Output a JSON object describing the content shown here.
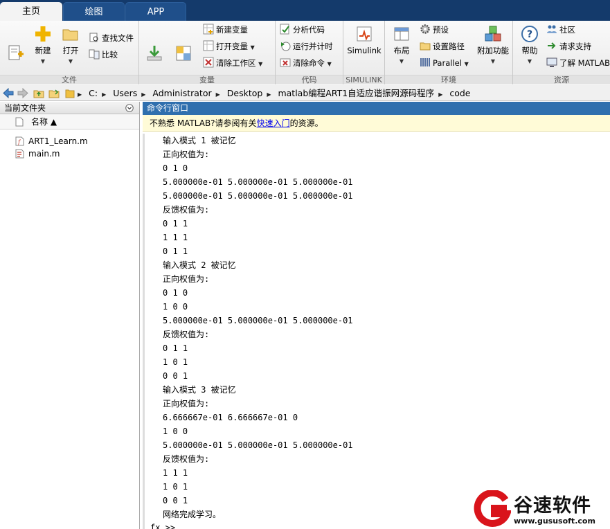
{
  "tabs": [
    "主页",
    "绘图",
    "APP"
  ],
  "ribbon": {
    "file_group": {
      "label": "文件",
      "new_script": "新建\n脚本",
      "new": "新建",
      "open": "打开",
      "find_files": "查找文件",
      "compare": "比较"
    },
    "variable_group": {
      "label": "变量",
      "import_data": "导入\n数据",
      "save_workspace": "保存\n工作区",
      "new_variable": "新建变量",
      "open_variable": "打开变量",
      "clear_workspace": "清除工作区"
    },
    "code_group": {
      "label": "代码",
      "analyze_code": "分析代码",
      "run_and_time": "运行并计时",
      "clear_commands": "清除命令"
    },
    "simulink_group": {
      "label": "SIMULINK",
      "simulink": "Simulink"
    },
    "env_group": {
      "label": "环境",
      "layout": "布局",
      "preferences": "预设",
      "set_path": "设置路径",
      "parallel": "Parallel",
      "addons": "附加功能"
    },
    "resources_group": {
      "label": "资源",
      "help": "帮助",
      "community": "社区",
      "request_support": "请求支持",
      "learn_matlab": "了解 MATLAB"
    }
  },
  "address": {
    "crumbs": [
      "C:",
      "Users",
      "Administrator",
      "Desktop",
      "matlab编程ART1自适应谐振网源码程序",
      "code"
    ]
  },
  "current_folder": {
    "title": "当前文件夹",
    "column_name": "名称 ▲",
    "files": [
      "ART1_Learn.m",
      "main.m"
    ]
  },
  "command_window": {
    "title": "命令行窗口",
    "info_prefix": "不熟悉 MATLAB?请参阅有关",
    "info_link": "快速入门",
    "info_suffix": "的资源。",
    "lines": [
      "输入模式 1 被记忆",
      "正向权值为:",
      "0 1 0",
      "5.000000e-01 5.000000e-01 5.000000e-01",
      "5.000000e-01 5.000000e-01 5.000000e-01",
      "反馈权值为:",
      "0 1 1",
      "1 1 1",
      "0 1 1",
      "输入模式 2 被记忆",
      "正向权值为:",
      "0 1 0",
      "1 0 0",
      "5.000000e-01 5.000000e-01 5.000000e-01",
      "反馈权值为:",
      "0 1 1",
      "1 0 1",
      "0 0 1",
      "输入模式 3 被记忆",
      "正向权值为:",
      "6.666667e-01 6.666667e-01 0",
      "1 0 0",
      "5.000000e-01 5.000000e-01 5.000000e-01",
      "反馈权值为:",
      "1 1 1",
      "1 0 1",
      "0 0 1",
      "网络完成学习。"
    ],
    "prompt": "fx >>"
  },
  "watermark": {
    "logo_letter": "G",
    "text": "谷速软件",
    "url": "www.gususoft.com"
  },
  "colors": {
    "tabbar": "#143a6b",
    "cmd_title": "#2f6fae",
    "infobar": "#fffbd7",
    "watermark_red": "#d9141b"
  }
}
